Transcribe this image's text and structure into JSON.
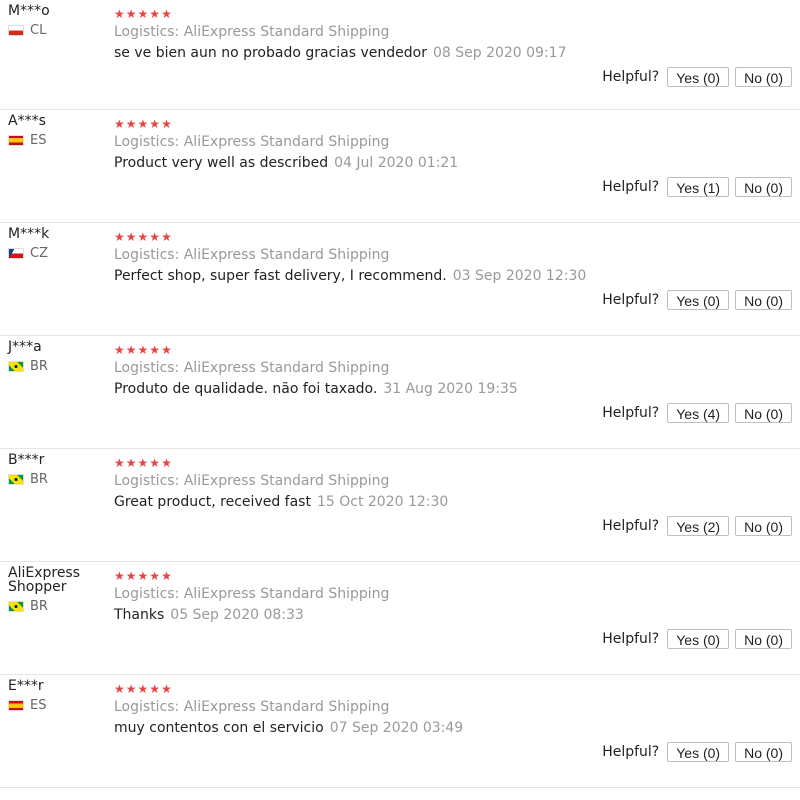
{
  "reviews": [
    {
      "username": "M***o",
      "country_code": "CL",
      "flag": "chile",
      "stars": 5,
      "logistics": "Logistics: AliExpress Standard Shipping",
      "text": "se ve bien aun no probado gracias vendedor",
      "date": "08 Sep 2020 09:17",
      "helpful_label": "Helpful?",
      "yes": "Yes (0)",
      "no": "No (0)"
    },
    {
      "username": "A***s",
      "country_code": "ES",
      "flag": "spain",
      "stars": 5,
      "logistics": "Logistics: AliExpress Standard Shipping",
      "text": "Product very well as described",
      "date": "04 Jul 2020 01:21",
      "helpful_label": "Helpful?",
      "yes": "Yes (1)",
      "no": "No (0)"
    },
    {
      "username": "M***k",
      "country_code": "CZ",
      "flag": "czech",
      "stars": 5,
      "logistics": "Logistics: AliExpress Standard Shipping",
      "text": "Perfect shop, super fast delivery, I recommend.",
      "date": "03 Sep 2020 12:30",
      "helpful_label": "Helpful?",
      "yes": "Yes (0)",
      "no": "No (0)"
    },
    {
      "username": "J***a",
      "country_code": "BR",
      "flag": "brazil",
      "stars": 5,
      "logistics": "Logistics: AliExpress Standard Shipping",
      "text": "Produto de qualidade. não foi taxado.",
      "date": "31 Aug 2020 19:35",
      "helpful_label": "Helpful?",
      "yes": "Yes (4)",
      "no": "No (0)"
    },
    {
      "username": "B***r",
      "country_code": "BR",
      "flag": "brazil",
      "stars": 5,
      "logistics": "Logistics: AliExpress Standard Shipping",
      "text": "Great product, received fast",
      "date": "15 Oct 2020 12:30",
      "helpful_label": "Helpful?",
      "yes": "Yes (2)",
      "no": "No (0)"
    },
    {
      "username": "AliExpress Shopper",
      "country_code": "BR",
      "flag": "brazil",
      "stars": 5,
      "logistics": "Logistics: AliExpress Standard Shipping",
      "text": "Thanks",
      "date": "05 Sep 2020 08:33",
      "helpful_label": "Helpful?",
      "yes": "Yes (0)",
      "no": "No (0)"
    },
    {
      "username": "E***r",
      "country_code": "ES",
      "flag": "spain",
      "stars": 5,
      "logistics": "Logistics: AliExpress Standard Shipping",
      "text": "muy contentos con el servicio",
      "date": "07 Sep 2020 03:49",
      "helpful_label": "Helpful?",
      "yes": "Yes (0)",
      "no": "No (0)"
    }
  ],
  "colors": {
    "star": "#e64545",
    "muted": "#999999",
    "border": "#e6e6e6"
  }
}
